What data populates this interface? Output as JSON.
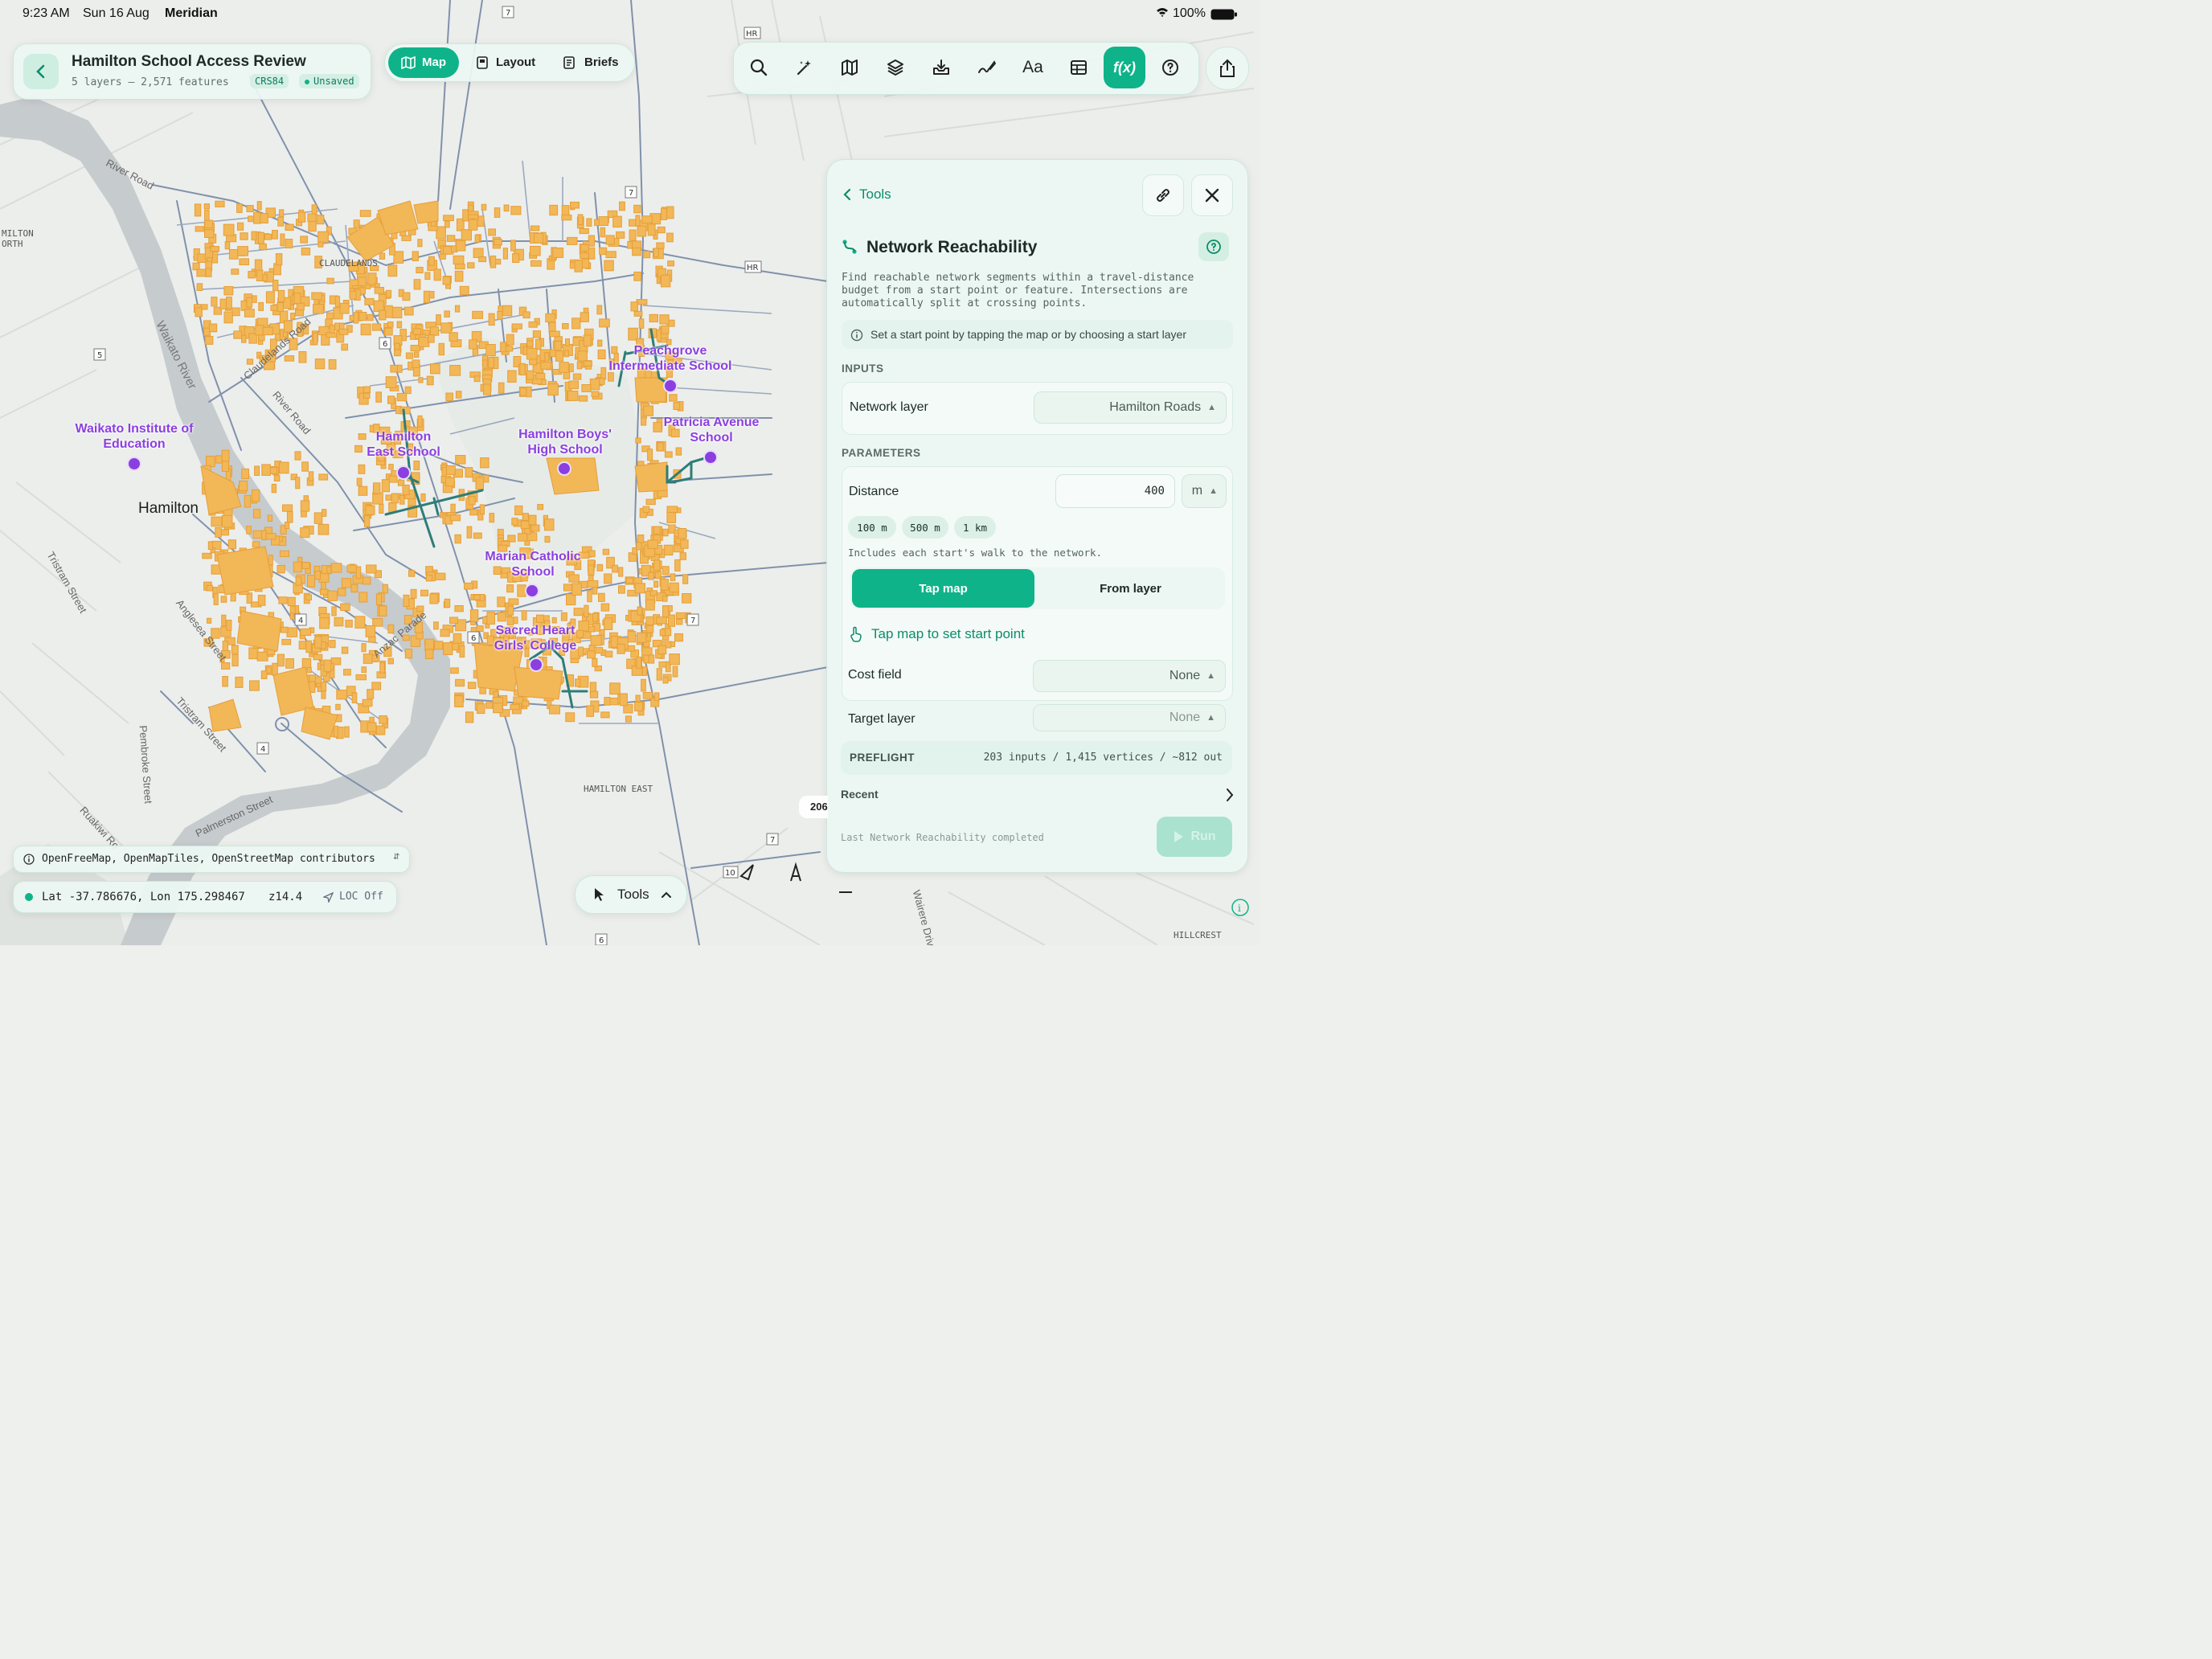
{
  "status_bar": {
    "time": "9:23 AM",
    "date": "Sun 16 Aug",
    "app": "Meridian",
    "battery": "100%"
  },
  "project": {
    "title": "Hamilton School Access Review",
    "summary": "5 layers – 2,571 features",
    "crs": "CRS84",
    "save_state": "Unsaved"
  },
  "view_tabs": [
    {
      "label": "Map",
      "icon": "map-icon",
      "active": true
    },
    {
      "label": "Layout",
      "icon": "layout-icon",
      "active": false
    },
    {
      "label": "Briefs",
      "icon": "briefs-icon",
      "active": false
    }
  ],
  "toolbar": {
    "buttons": [
      "search-icon",
      "magic-wand-icon",
      "basemap-icon",
      "layers-icon",
      "import-icon",
      "draw-icon",
      "text-style-icon",
      "table-icon",
      "function-icon",
      "help-icon"
    ],
    "function_label": "f(x)",
    "text_label": "Aa",
    "share": "share-icon"
  },
  "panel": {
    "back_label": "Tools",
    "title": "Network Reachability",
    "description": "Find reachable network segments within a travel-distance budget from a start point or feature. Intersections are automatically split at crossing points.",
    "hint": "Set a start point by tapping the map or by choosing a start layer",
    "inputs_header": "INPUTS",
    "network_layer_label": "Network layer",
    "network_layer_value": "Hamilton Roads",
    "parameters_header": "PARAMETERS",
    "distance_label": "Distance",
    "distance_value": "400",
    "distance_unit": "m",
    "presets": [
      "100 m",
      "500 m",
      "1 km"
    ],
    "walk_note": "Includes each start's walk to the network.",
    "mode_tap": "Tap map",
    "mode_layer": "From layer",
    "tap_prompt": "Tap map to set start point",
    "cost_field_label": "Cost field",
    "cost_field_value": "None",
    "target_layer_label": "Target layer",
    "target_layer_value": "None",
    "preflight_label": "PREFLIGHT",
    "preflight_value": "203 inputs / 1,415 vertices / ~812 out",
    "recent_label": "Recent",
    "last_run": "Last Network Reachability completed",
    "run_label": "Run"
  },
  "map": {
    "attribution": "OpenFreeMap, OpenMapTiles, OpenStreetMap contributors",
    "lat_label": "Lat -37.786676, Lon 175.298467",
    "zoom": "z14.4",
    "location": "LOC Off",
    "tools_button": "Tools",
    "scale_partial": "206",
    "schools": [
      {
        "name": "Waikato Institute of Education"
      },
      {
        "name": "Hamilton East School"
      },
      {
        "name": "Hamilton Boys' High School"
      },
      {
        "name": "Peachgrove Intermediate School"
      },
      {
        "name": "Patricia Avenue School"
      },
      {
        "name": "Marian Catholic School"
      },
      {
        "name": "Sacred Heart Girls' College"
      }
    ],
    "places": {
      "city": "Hamilton",
      "claudelands": "CLAUDELANDS",
      "hamilton_east": "HAMILTON EAST",
      "hillcrest": "HILLCREST",
      "milton_north": "MILTON ORTH",
      "river": "Waikato River",
      "river_road": "River Road",
      "river_road_2": "River Road",
      "claudelands_road": "Claudelands Road",
      "tristram": "Tristram Street",
      "tristram_2": "Tristram Street",
      "anglesea": "Anglesea Street",
      "anzac": "Anzac Parade",
      "pembroke": "Pembroke Street",
      "ruakiwi": "Ruakiwi Ro",
      "palmerston": "Palmerston Street",
      "wairere": "Wairere Driv"
    },
    "route_shields": [
      "7",
      "HR",
      "5",
      "6",
      "4",
      "4",
      "7",
      "7",
      "6",
      "HR",
      "7",
      "10",
      "6"
    ]
  },
  "colors": {
    "accent": "#0fb389",
    "school": "#8b3fe0",
    "building": "#f2b757",
    "reachable": "#2e7d78",
    "road": "#7b8aa3",
    "river": "#c4c9cc"
  }
}
